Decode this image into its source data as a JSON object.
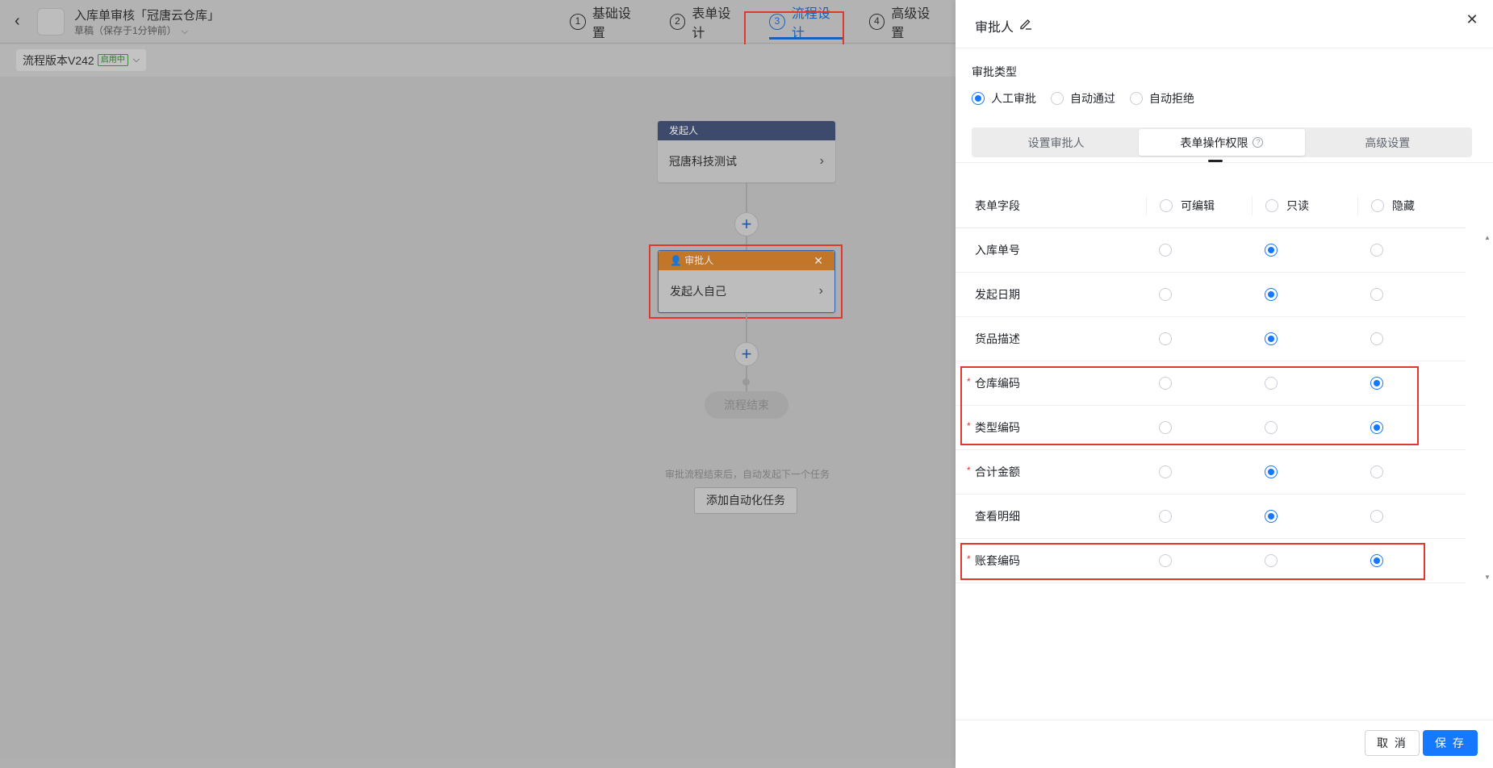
{
  "header": {
    "title": "入库单审核「冠唐云仓库」",
    "subtitle": "草稿（保存于1分钟前）",
    "steps": [
      {
        "num": "1",
        "label": "基础设置"
      },
      {
        "num": "2",
        "label": "表单设计"
      },
      {
        "num": "3",
        "label": "流程设计"
      },
      {
        "num": "4",
        "label": "高级设置"
      }
    ],
    "active_step": 3
  },
  "version": {
    "label": "流程版本V242",
    "tag": "启用中"
  },
  "flow": {
    "initiator": {
      "head": "发起人",
      "body": "冠唐科技测试"
    },
    "approver": {
      "head": "审批人",
      "body": "发起人自己"
    },
    "end": "流程结束",
    "auto_hint": "审批流程结束后，自动发起下一个任务",
    "auto_button": "添加自动化任务"
  },
  "drawer": {
    "title": "审批人",
    "approval_type_label": "审批类型",
    "approval_types": [
      "人工审批",
      "自动通过",
      "自动拒绝"
    ],
    "approval_type_selected": 0,
    "tabs": [
      "设置审批人",
      "表单操作权限",
      "高级设置"
    ],
    "active_tab": 1,
    "table": {
      "columns": [
        "表单字段",
        "可编辑",
        "只读",
        "隐藏"
      ],
      "rows": [
        {
          "field": "入库单号",
          "required": false,
          "perm": "只读"
        },
        {
          "field": "发起日期",
          "required": false,
          "perm": "只读"
        },
        {
          "field": "货品描述",
          "required": false,
          "perm": "只读"
        },
        {
          "field": "仓库编码",
          "required": true,
          "perm": "隐藏"
        },
        {
          "field": "类型编码",
          "required": true,
          "perm": "隐藏"
        },
        {
          "field": "合计金额",
          "required": true,
          "perm": "只读"
        },
        {
          "field": "查看明细",
          "required": false,
          "perm": "只读"
        },
        {
          "field": "账套编码",
          "required": true,
          "perm": "隐藏"
        }
      ]
    },
    "required_mark": "*",
    "cancel_label": "取 消",
    "save_label": "保 存"
  },
  "colors": {
    "accent": "#1677ff",
    "highlight_box": "#e0392b",
    "initiator_head": "#3d4a6b",
    "approver_head": "#c2762a"
  }
}
